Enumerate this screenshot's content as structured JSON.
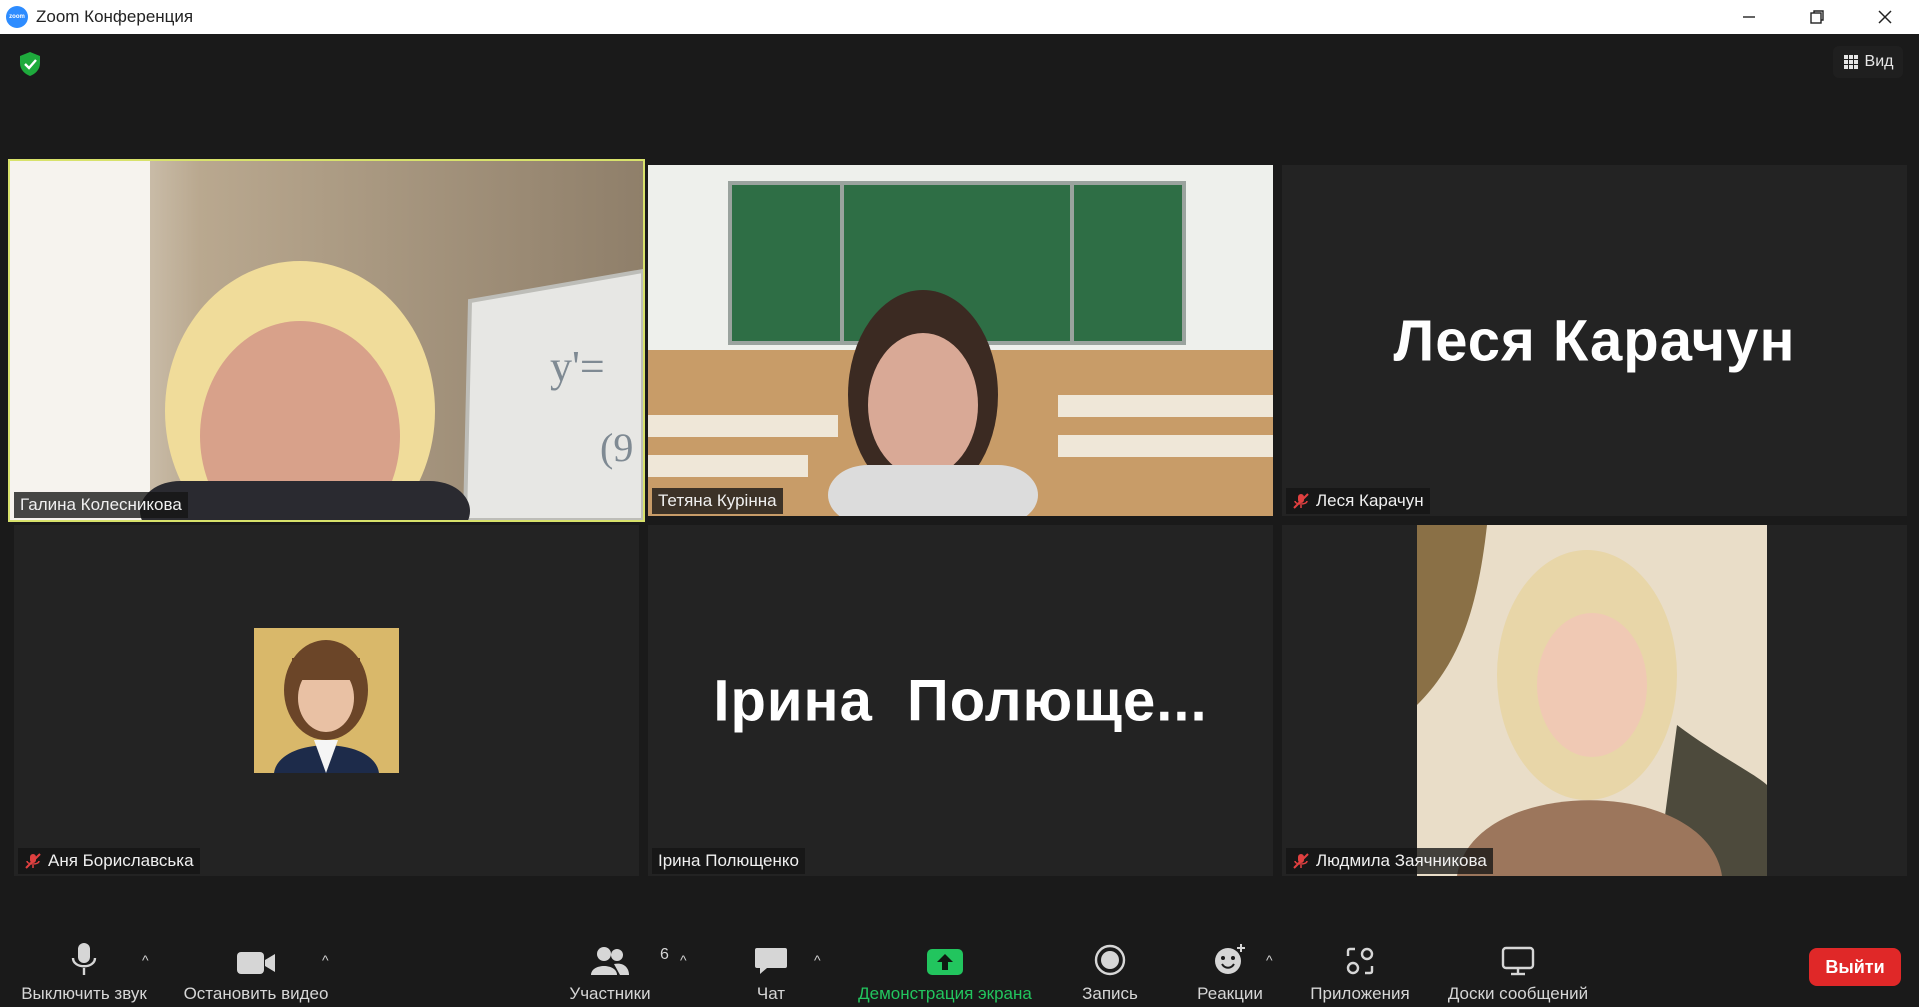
{
  "window": {
    "title": "Zoom Конференция",
    "logo_text": "zoom"
  },
  "header": {
    "view_label": "Вид"
  },
  "participants": [
    {
      "name": "Галина Колесникова",
      "muted": false,
      "video": true,
      "active_speaker": true
    },
    {
      "name": "Тетяна Курінна",
      "muted": false,
      "video": true,
      "active_speaker": false
    },
    {
      "name": "Леся Карачун",
      "display": "Леся Карачун",
      "muted": true,
      "video": false,
      "active_speaker": false
    },
    {
      "name": "Аня Бориславська",
      "muted": true,
      "video": false,
      "active_speaker": false
    },
    {
      "name": "Ірина Полющенко",
      "display": "Ірина  Полюще...",
      "muted": false,
      "video": false,
      "active_speaker": false
    },
    {
      "name": "Людмила Заячникова",
      "muted": true,
      "video": true,
      "active_speaker": false
    }
  ],
  "toolbar": {
    "mute_label": "Выключить звук",
    "video_label": "Остановить видео",
    "participants_label": "Участники",
    "participants_count": "6",
    "chat_label": "Чат",
    "share_label": "Демонстрация экрана",
    "record_label": "Запись",
    "reactions_label": "Реакции",
    "apps_label": "Приложения",
    "whiteboards_label": "Доски сообщений",
    "leave_label": "Выйти"
  },
  "colors": {
    "active_speaker_border": "#d8e26b",
    "share_green": "#22c55e",
    "leave_red": "#e02828",
    "muted_red": "#e04040"
  }
}
